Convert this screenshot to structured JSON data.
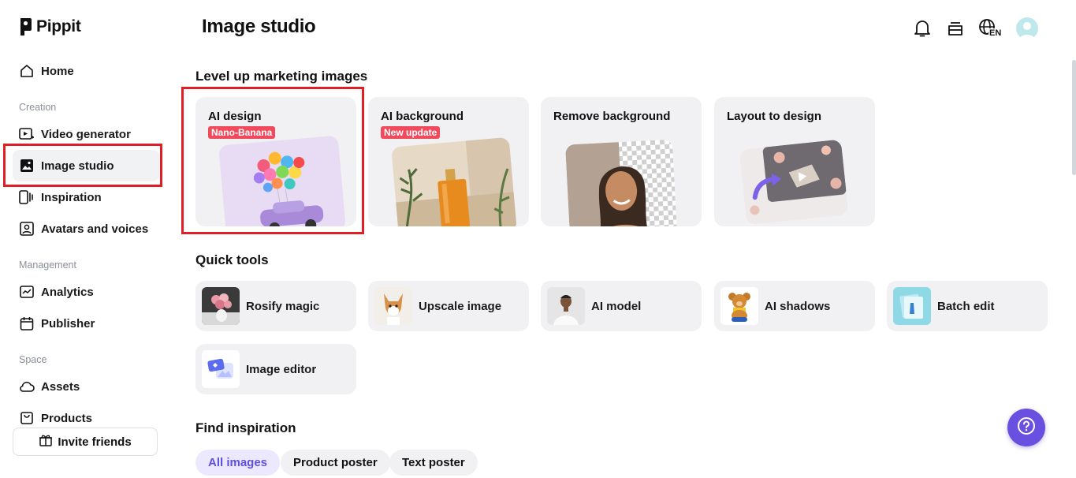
{
  "app": {
    "name": "Pippit"
  },
  "sidebar": {
    "items": [
      {
        "label": "Home",
        "icon": "home-icon"
      },
      {
        "label": "Video generator",
        "icon": "video-generator-icon"
      },
      {
        "label": "Image studio",
        "icon": "image-studio-icon",
        "active": true
      },
      {
        "label": "Inspiration",
        "icon": "inspiration-icon"
      },
      {
        "label": "Avatars and voices",
        "icon": "avatar-icon"
      },
      {
        "label": "Analytics",
        "icon": "analytics-icon"
      },
      {
        "label": "Publisher",
        "icon": "calendar-icon"
      },
      {
        "label": "Assets",
        "icon": "cloud-icon"
      },
      {
        "label": "Products",
        "icon": "bag-icon"
      }
    ],
    "sections": {
      "creation": "Creation",
      "management": "Management",
      "space": "Space"
    },
    "invite_label": "Invite friends"
  },
  "header": {
    "title": "Image studio",
    "language": "EN"
  },
  "marketing": {
    "heading": "Level up marketing images",
    "cards": [
      {
        "title": "AI design",
        "badge": "Nano-Banana"
      },
      {
        "title": "AI background",
        "badge": "New update"
      },
      {
        "title": "Remove background",
        "badge": ""
      },
      {
        "title": "Layout to design",
        "badge": ""
      }
    ]
  },
  "quick_tools": {
    "heading": "Quick tools",
    "items": [
      {
        "label": "Rosify magic"
      },
      {
        "label": "Upscale image"
      },
      {
        "label": "AI model"
      },
      {
        "label": "AI shadows"
      },
      {
        "label": "Batch edit"
      },
      {
        "label": "Image editor"
      }
    ]
  },
  "inspiration": {
    "heading": "Find inspiration",
    "chips": [
      "All images",
      "Product poster",
      "Text poster"
    ],
    "active_chip": "All images"
  },
  "colors": {
    "accent": "#6a50e0",
    "highlight": "#e01e25",
    "badge": "#f04a5c",
    "card_bg": "#f1f1f3"
  }
}
